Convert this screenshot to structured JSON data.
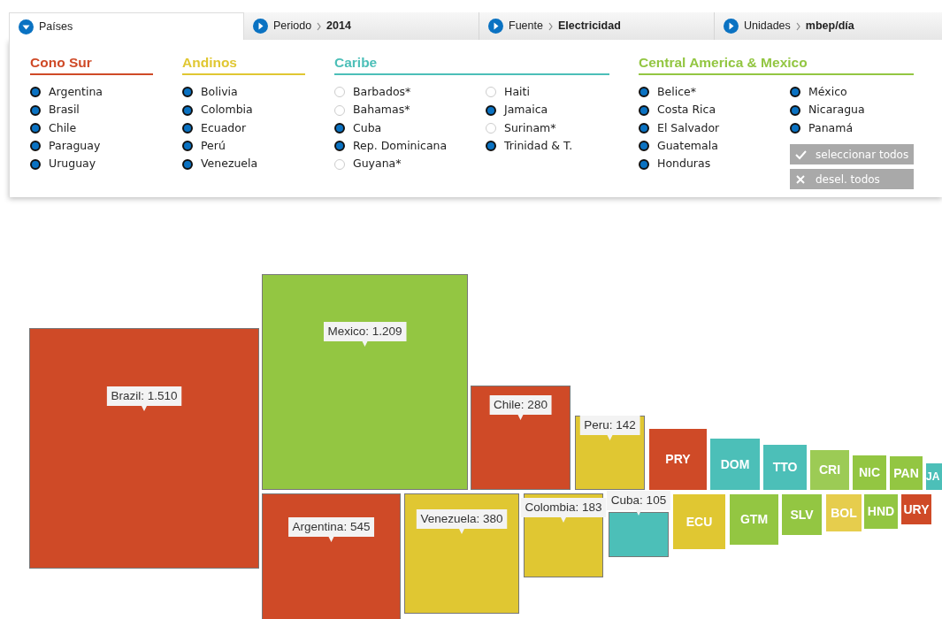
{
  "tabs": [
    {
      "label": "Países",
      "selected": true
    },
    {
      "label": "Periodo",
      "value": "2014",
      "selected": false
    },
    {
      "label": "Fuente",
      "value": "Electricidad",
      "selected": false
    },
    {
      "label": "Unidades",
      "value": "mbep/día",
      "selected": false
    }
  ],
  "groups": [
    {
      "title": "Cono Sur",
      "color": "#cf4a27",
      "columns": [
        [
          {
            "name": "Argentina",
            "selected": true
          },
          {
            "name": "Brasil",
            "selected": true
          },
          {
            "name": "Chile",
            "selected": true
          },
          {
            "name": "Paraguay",
            "selected": true
          },
          {
            "name": "Uruguay",
            "selected": true
          }
        ]
      ]
    },
    {
      "title": "Andinos",
      "color": "#e0c732",
      "columns": [
        [
          {
            "name": "Bolivia",
            "selected": true
          },
          {
            "name": "Colombia",
            "selected": true
          },
          {
            "name": "Ecuador",
            "selected": true
          },
          {
            "name": "Perú",
            "selected": true
          },
          {
            "name": "Venezuela",
            "selected": true
          }
        ]
      ]
    },
    {
      "title": "Caribe",
      "color": "#4cbfb8",
      "columns": [
        [
          {
            "name": "Barbados*",
            "selected": false
          },
          {
            "name": "Bahamas*",
            "selected": false
          },
          {
            "name": "Cuba",
            "selected": true
          },
          {
            "name": "Rep. Dominicana",
            "selected": true
          },
          {
            "name": "Guyana*",
            "selected": false
          }
        ],
        [
          {
            "name": "Haiti",
            "selected": false
          },
          {
            "name": "Jamaica",
            "selected": true
          },
          {
            "name": "Surinam*",
            "selected": false
          },
          {
            "name": "Trinidad & T.",
            "selected": true
          }
        ]
      ]
    },
    {
      "title": "Central America & Mexico",
      "color": "#93c642",
      "columns": [
        [
          {
            "name": "Belice*",
            "selected": true
          },
          {
            "name": "Costa Rica",
            "selected": true
          },
          {
            "name": "El Salvador",
            "selected": true
          },
          {
            "name": "Guatemala",
            "selected": true
          },
          {
            "name": "Honduras",
            "selected": true
          }
        ],
        [
          {
            "name": "México",
            "selected": true
          },
          {
            "name": "Nicaragua",
            "selected": true
          },
          {
            "name": "Panamá",
            "selected": true
          }
        ]
      ]
    }
  ],
  "buttons": [
    {
      "label": "seleccionar todos",
      "kind": "check"
    },
    {
      "label": "desel. todos",
      "kind": "clear"
    }
  ],
  "squares": [
    {
      "kind": "tooltip",
      "label": "Brazil: 1.510",
      "color": "#cf4a27"
    },
    {
      "kind": "tooltip",
      "label": "Mexico: 1.209",
      "color": "#93c642"
    },
    {
      "kind": "tooltip",
      "label": "Argentina: 545",
      "color": "#cf4a27"
    },
    {
      "kind": "tooltip",
      "label": "Venezuela: 380",
      "color": "#e0c732"
    },
    {
      "kind": "tooltip",
      "label": "Chile: 280",
      "color": "#cf4a27"
    },
    {
      "kind": "tooltip",
      "label": "Colombia: 183",
      "color": "#e0c732"
    },
    {
      "kind": "tooltip",
      "label": "Peru: 142",
      "color": "#e0c732"
    },
    {
      "kind": "tooltip",
      "label": "Cuba: 105",
      "color": "#4cbfb8"
    },
    {
      "kind": "code",
      "label": "PRY",
      "color": "#cf4a27"
    },
    {
      "kind": "code",
      "label": "DOM",
      "color": "#4cbfb8"
    },
    {
      "kind": "code",
      "label": "ECU",
      "color": "#e0c732"
    },
    {
      "kind": "code",
      "label": "TTO",
      "color": "#4cbfb8"
    },
    {
      "kind": "code",
      "label": "GTM",
      "color": "#93c642"
    },
    {
      "kind": "code",
      "label": "CRI",
      "color": "#9ccb55"
    },
    {
      "kind": "code",
      "label": "SLV",
      "color": "#93c642"
    },
    {
      "kind": "code",
      "label": "NIC",
      "color": "#93c642"
    },
    {
      "kind": "code",
      "label": "PAN",
      "color": "#93c642"
    },
    {
      "kind": "code",
      "label": "BOL",
      "color": "#e6cd4d"
    },
    {
      "kind": "code",
      "label": "HND",
      "color": "#93c642"
    },
    {
      "kind": "code",
      "label": "URY",
      "color": "#cf4a27"
    },
    {
      "kind": "code",
      "label": "JA",
      "color": "#4cbfb8"
    }
  ]
}
